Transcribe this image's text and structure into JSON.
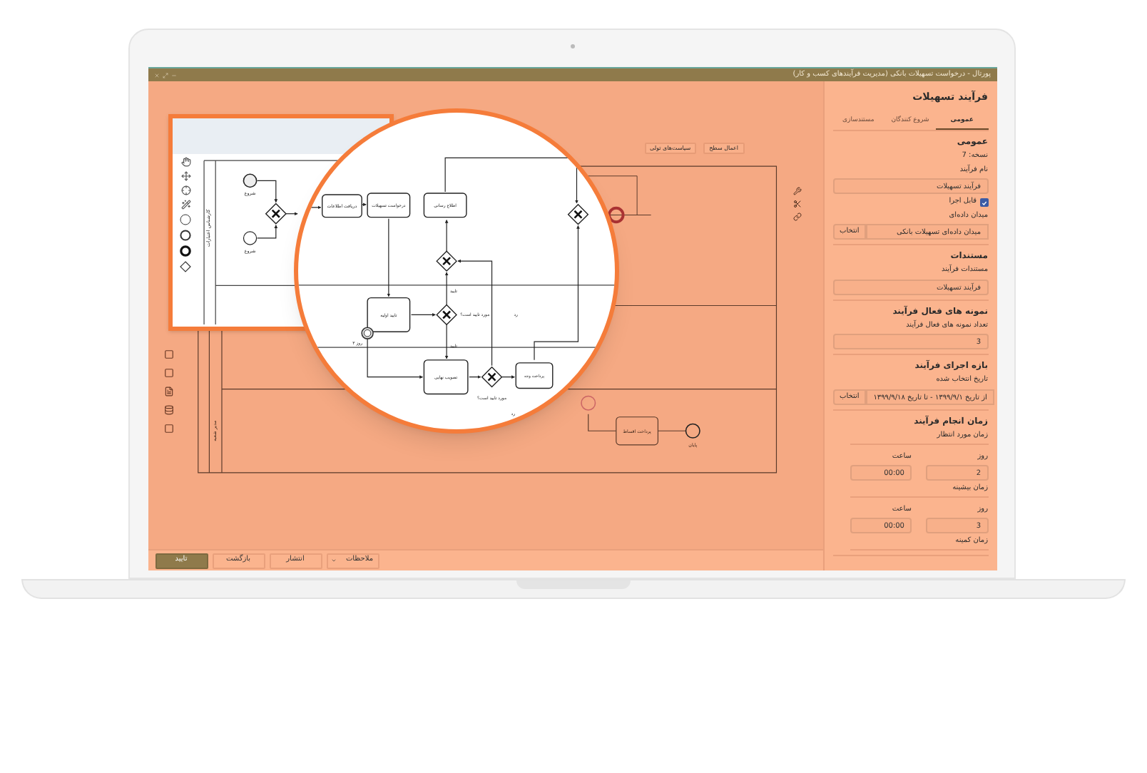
{
  "window": {
    "title": "پورتال - درخواست تسهیلات بانکی (مدیریت فرآیندهای کسب و کار)"
  },
  "canvas_actions": [
    "اعمال سطح",
    "سیاست‌های تولی"
  ],
  "diagram": {
    "lane_labels": [
      "کارشناس اعتبارات",
      "مدیر شعبه"
    ],
    "start_events": [
      "شروع",
      "شروع"
    ],
    "tasks": [
      "اطلاع رسانی",
      "درخواست تسهیلات",
      "دریافت اطلاعات",
      "تایید اولیه",
      "پرداخت وجه",
      "تصویب نهایی",
      "پرداخت اقساط"
    ],
    "flow_labels": [
      "تایید",
      "رد",
      "مورد تایید است؟",
      "تایید",
      "مورد تایید است؟",
      "رد"
    ],
    "timer_label": "۳ روز",
    "end_label": "پایان"
  },
  "panel": {
    "title": "فرآیند تسهیلات",
    "tabs": [
      {
        "label": "عمومی",
        "selected": true
      },
      {
        "label": "شروع کنندگان",
        "selected": false
      },
      {
        "label": "مستندسازی",
        "selected": false
      }
    ],
    "sections": [
      {
        "title": "عمومی",
        "version": "نسخه: 7",
        "fields": [
          {
            "label": "نام فرآیند",
            "value": "فرآیند تسهیلات"
          }
        ],
        "checkbox": {
          "label": "قابل اجرا",
          "checked": true
        },
        "pickers": [
          {
            "label": "میدان داده‌ای",
            "value": "میدان داده‌ای تسهیلات بانکی",
            "button": "انتخاب"
          }
        ]
      },
      {
        "title": "مستندات",
        "fields": [
          {
            "label": "مستندات فرآیند",
            "value": "فرآیند تسهیلات"
          }
        ]
      },
      {
        "title": "نمونه های فعال فرآیند",
        "fields": [
          {
            "label": "تعداد نمونه های فعال فرآیند",
            "value": "3"
          }
        ]
      },
      {
        "title": "بازه اجرای فرآیند",
        "pickers": [
          {
            "label": "تاریخ انتخاب شده",
            "value": "از تاریخ ۱۳۹۹/۹/۱ - تا تاریخ ۱۳۹۹/۹/۱۸",
            "button": "انتخاب"
          }
        ]
      },
      {
        "title": "زمان انجام فرآیند",
        "durations": [
          {
            "label": "زمان مورد انتظار",
            "day_label": "روز",
            "day": "2",
            "hour_label": "ساعت",
            "hour": "00:00"
          },
          {
            "label": "زمان بیشینه",
            "day_label": "روز",
            "day": "3",
            "hour_label": "ساعت",
            "hour": "00:00"
          },
          {
            "label": "زمان کمینه"
          }
        ]
      }
    ]
  },
  "footer_buttons": [
    {
      "label": "ملاحظات",
      "kind": "dropdown"
    },
    {
      "label": "انتشار",
      "kind": "plain"
    },
    {
      "label": "بازگشت",
      "kind": "plain"
    },
    {
      "label": "تایید",
      "kind": "primary"
    }
  ]
}
